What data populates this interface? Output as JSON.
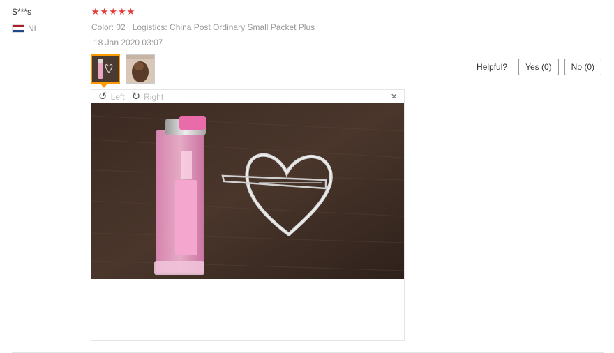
{
  "review": {
    "user": "S***s",
    "country_code": "NL",
    "rating": 5,
    "stars": [
      "★",
      "★",
      "★",
      "★",
      "★"
    ],
    "color_label": "Color: 02",
    "logistics_label": "Logistics: China Post Ordinary Small Packet Plus",
    "date": "18 Jan 2020 03:07"
  },
  "helpful": {
    "label": "Helpful?",
    "yes_label": "Yes (0)",
    "no_label": "No (0)"
  },
  "viewer": {
    "rotate_left_label": "Left",
    "rotate_right_label": "Right",
    "close_glyph": "×"
  },
  "colors": {
    "star": "#e33b3b",
    "active_thumb_border": "#ff9900",
    "flag_red": "#ae1c28",
    "flag_white": "#ffffff",
    "flag_blue": "#21468b"
  }
}
